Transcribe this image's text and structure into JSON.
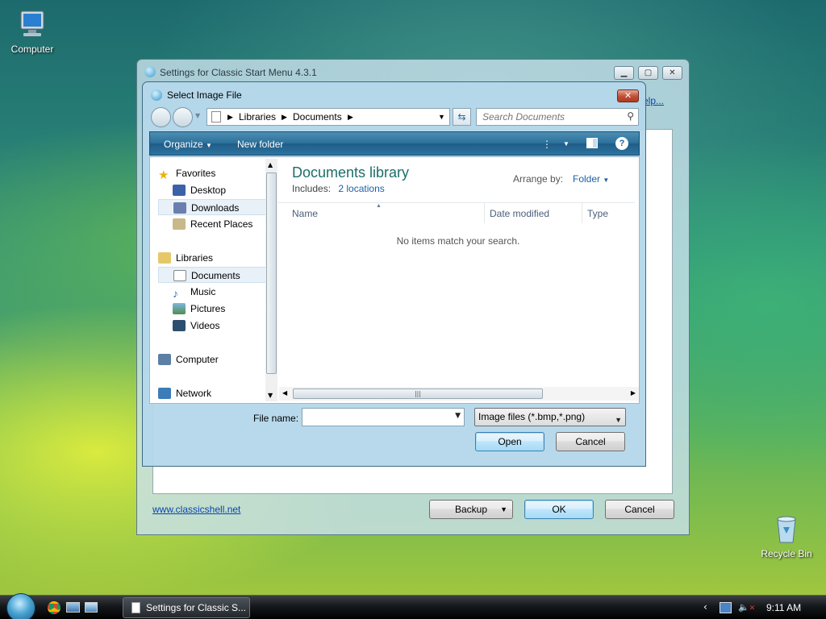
{
  "desktop": {
    "computer_label": "Computer",
    "recycle_label": "Recycle Bin"
  },
  "settings_window": {
    "title": "Settings for Classic Start Menu 4.3.1",
    "help_link": "elp...",
    "website_link": "www.classicshell.net",
    "backup_label": "Backup",
    "ok_label": "OK",
    "cancel_label": "Cancel"
  },
  "dialog": {
    "title": "Select Image File",
    "breadcrumb": [
      "Libraries",
      "Documents"
    ],
    "search_placeholder": "Search Documents",
    "toolbar": {
      "organize": "Organize",
      "new_folder": "New folder",
      "help": "?"
    },
    "nav": {
      "favorites": "Favorites",
      "favorites_items": [
        "Desktop",
        "Downloads",
        "Recent Places"
      ],
      "libraries": "Libraries",
      "libraries_items": [
        "Documents",
        "Music",
        "Pictures",
        "Videos"
      ],
      "computer": "Computer",
      "network": "Network"
    },
    "library": {
      "title": "Documents library",
      "includes_label": "Includes:",
      "includes_link": "2 locations",
      "arrange_label": "Arrange by:",
      "arrange_value": "Folder"
    },
    "columns": [
      "Name",
      "Date modified",
      "Type"
    ],
    "empty_message": "No items match your search.",
    "filename_label": "File name:",
    "filename_value": "",
    "filter_value": "Image files (*.bmp,*.png)",
    "open_label": "Open",
    "cancel_label": "Cancel"
  },
  "taskbar": {
    "task_label": "Settings for Classic S...",
    "clock": "9:11 AM"
  }
}
